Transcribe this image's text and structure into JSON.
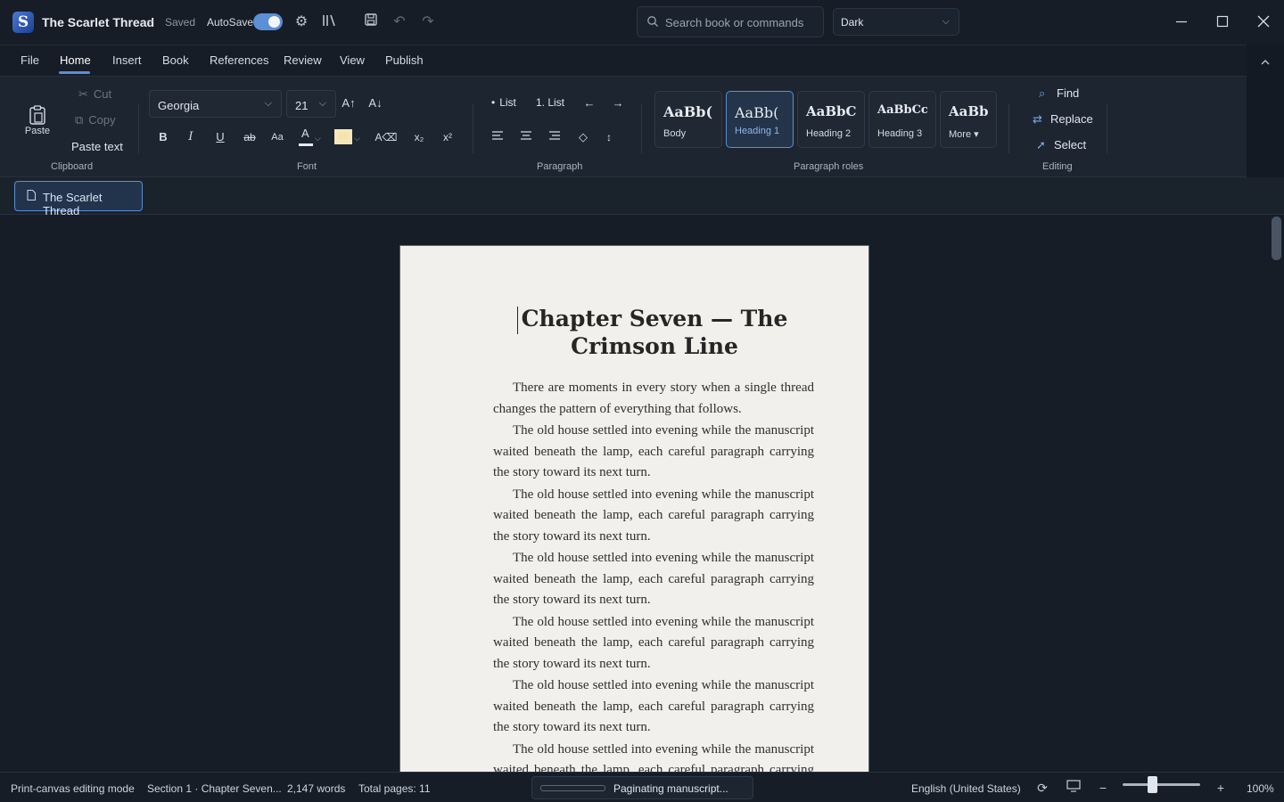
{
  "window": {
    "doc_title": "The Scarlet Thread",
    "save_status": "Saved",
    "autosave_label": "AutoSave",
    "autosave_on": true,
    "search_placeholder": "Search book or commands",
    "theme": "Dark"
  },
  "menu": {
    "items": [
      "File",
      "Home",
      "Insert",
      "Book",
      "References",
      "Review",
      "View",
      "Publish"
    ],
    "active": "Home"
  },
  "ribbon": {
    "clipboard": {
      "label": "Clipboard",
      "paste": "Paste",
      "cut": "Cut",
      "copy": "Copy",
      "paste_text": "Paste text"
    },
    "font": {
      "label": "Font",
      "family": "Georgia",
      "size": "21"
    },
    "paragraph": {
      "label": "Paragraph",
      "bullet_list": "List",
      "numbered_list": "1. List",
      "bullet_glyph": "•"
    },
    "roles": {
      "label": "Paragraph roles",
      "styles": [
        {
          "sample": "AaBb(",
          "name": "Body",
          "selected": false
        },
        {
          "sample": "AaBb(",
          "name": "Heading 1",
          "selected": true
        },
        {
          "sample": "AaBbC",
          "name": "Heading 2",
          "selected": false
        },
        {
          "sample": "AaBbCc",
          "name": "Heading 3",
          "selected": false
        },
        {
          "sample": "AaBb",
          "name": "More ▾",
          "selected": false
        }
      ]
    },
    "editing": {
      "label": "Editing",
      "find": "Find",
      "replace": "Replace",
      "select": "Select"
    }
  },
  "tabs": {
    "open_doc": "The Scarlet Thread"
  },
  "page": {
    "title": "Chapter Seven — The Crimson Line",
    "paragraphs": [
      "There are moments in every story when a single thread changes the pattern of everything that follows.",
      "The old house settled into evening while the manuscript waited beneath the lamp, each careful paragraph carrying the story toward its next turn.",
      "The old house settled into evening while the manuscript waited beneath the lamp, each careful paragraph carrying the story toward its next turn.",
      "The old house settled into evening while the manuscript waited beneath the lamp, each careful paragraph carrying the story toward its next turn.",
      "The old house settled into evening while the manuscript waited beneath the lamp, each careful paragraph carrying the story toward its next turn.",
      "The old house settled into evening while the manuscript waited beneath the lamp, each careful paragraph carrying the story toward its next turn.",
      "The old house settled into evening while the manuscript waited beneath the lamp, each careful paragraph carrying the story toward its next turn."
    ]
  },
  "status": {
    "mode": "Print-canvas editing mode",
    "section": "Section 1 · Chapter Seven...",
    "words": "2,147 words",
    "pages": "Total pages: 11",
    "progress_label": "Paginating manuscript...",
    "progress": 0.0,
    "language": "English (United States)",
    "zoom": "100%"
  },
  "colors": {
    "accent": "#5b8fd6",
    "page": "#f1f0ec",
    "background": "#161d27"
  }
}
